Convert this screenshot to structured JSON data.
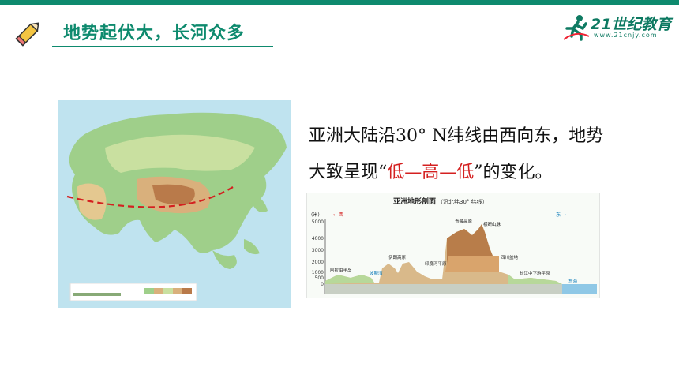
{
  "header": {
    "title": "地势起伏大，长河众多",
    "logo_main": "21世纪教育",
    "logo_sub": "www.21cnjy.com"
  },
  "text": {
    "line1": "亚洲大陆沿30° N纬线由西向东，地势",
    "line2_pre": "大致呈现“",
    "line2_highlight": "低—高—低",
    "line2_post": "”的变化。"
  },
  "profile": {
    "title": "亚洲地形剖面",
    "subtitle": "（沿北纬30° 纬线）",
    "unit": "(米)",
    "west": "← 西",
    "east": "东 →",
    "yticks": [
      "5000",
      "4000",
      "3000",
      "2000",
      "1000",
      "500",
      "0"
    ],
    "labels": {
      "arabia": "阿拉伯半岛",
      "persian_gulf": "波斯湾",
      "iran": "伊朗高原",
      "indus": "印度河平原",
      "tibet": "青藏高原",
      "hengduan": "横断山脉",
      "sichuan": "四川盆地",
      "yangtze": "长江中下游平原",
      "east_sea": "东海"
    }
  },
  "colors": {
    "brand": "#0e8a6e",
    "highlight": "#d42020"
  }
}
